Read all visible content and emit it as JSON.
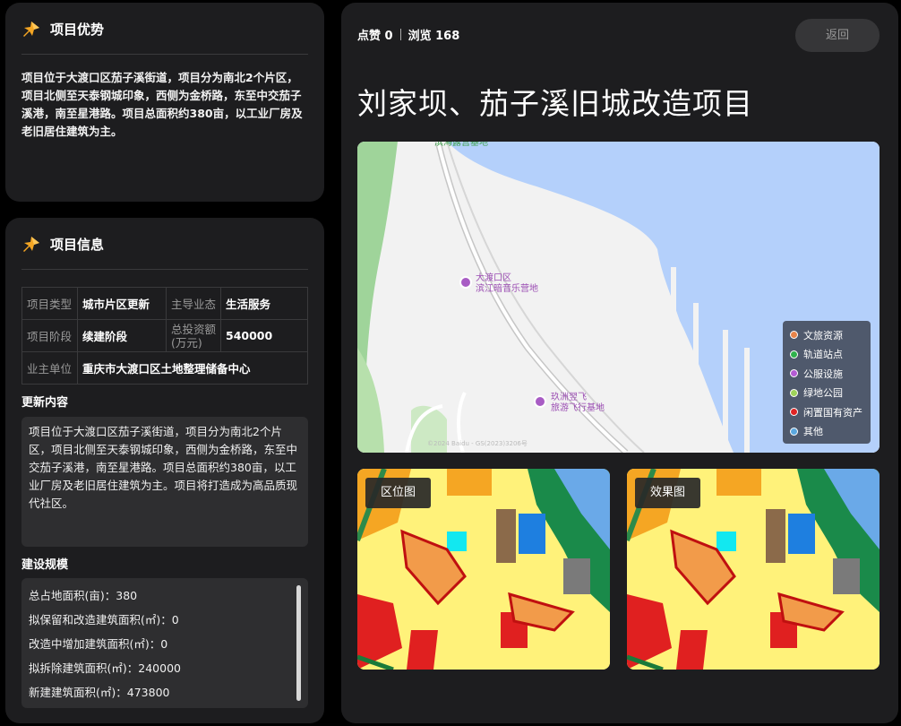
{
  "advantage": {
    "title": "项目优势",
    "text": "项目位于大渡口区茄子溪街道，项目分为南北2个片区，项目北侧至天泰钢城印象，西侧为金桥路，东至中交茄子溪港，南至星港路。项目总面积约380亩，以工业厂房及老旧居住建筑为主。"
  },
  "info": {
    "title": "项目信息",
    "table": {
      "type_label": "项目类型",
      "type_value": "城市片区更新",
      "business_label": "主导业态",
      "business_value": "生活服务",
      "stage_label": "项目阶段",
      "stage_value": "续建阶段",
      "invest_label": "总投资额\n(万元)",
      "invest_value": "540000",
      "owner_label": "业主单位",
      "owner_value": "重庆市大渡口区土地整理储备中心"
    },
    "update_title": "更新内容",
    "update_text": "项目位于大渡口区茄子溪街道，项目分为南北2个片区，项目北侧至天泰钢城印象，西侧为金桥路，东至中交茄子溪港，南至星港路。项目总面积约380亩，以工业厂房及老旧居住建筑为主。项目将打造成为高品质现代社区。",
    "scale_title": "建设规模",
    "scale_rows": [
      "总占地面积(亩)：380",
      "拟保留和改造建筑面积(㎡)：0",
      "改造中增加建筑面积(㎡)：0",
      "拟拆除建筑面积(㎡)：240000",
      "新建建筑面积(㎡)：473800"
    ]
  },
  "main": {
    "likes": "点赞 0",
    "views": "浏览 168",
    "back_label": "返回",
    "title": "刘家坝、茄子溪旧城改造项目",
    "map": {
      "poi1": "大渡口区\n滨江暗音乐营地",
      "poi2": "玖洲翌飞\n旅游飞行基地",
      "poi_top": "滨海露营基地",
      "copyright": "©2024 Baidu - GS(2023)3206号",
      "legend": [
        {
          "label": "文旅资源",
          "color": "#e8844a"
        },
        {
          "label": "轨道站点",
          "color": "#2fb24c"
        },
        {
          "label": "公服设施",
          "color": "#b45bd4"
        },
        {
          "label": "绿地公园",
          "color": "#9ed35a"
        },
        {
          "label": "闲置国有资产",
          "color": "#e02424"
        },
        {
          "label": "其他",
          "color": "#5aa7de"
        }
      ]
    },
    "thumb1_label": "区位图",
    "thumb2_label": "效果图"
  },
  "colors": {
    "card_bg": "#1d1d1f",
    "page_bg": "#000000",
    "water": "#b4d0fb"
  }
}
